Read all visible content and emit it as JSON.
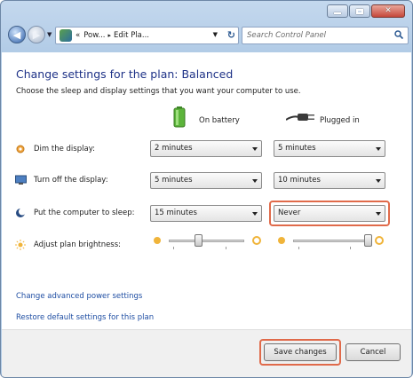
{
  "window": {
    "title_buttons": [
      "minimize",
      "maximize",
      "close"
    ]
  },
  "nav": {
    "back_icon": "back-arrow-icon",
    "forward_icon": "forward-arrow-icon",
    "breadcrumb_prefix": "«",
    "breadcrumb_1": "Pow...",
    "breadcrumb_2": "Edit Pla...",
    "breadcrumb_sep": "▸",
    "search_placeholder": "Search Control Panel"
  },
  "content": {
    "title": "Change settings for the plan: Balanced",
    "subtitle": "Choose the sleep and display settings that you want your computer to use.",
    "col_battery": "On battery",
    "col_plugged": "Plugged in",
    "rows": [
      {
        "label": "Dim the display:",
        "battery": "2 minutes",
        "plugged": "5 minutes"
      },
      {
        "label": "Turn off the display:",
        "battery": "5 minutes",
        "plugged": "10 minutes"
      },
      {
        "label": "Put the computer to sleep:",
        "battery": "15 minutes",
        "plugged": "Never"
      }
    ],
    "brightness": {
      "label": "Adjust plan brightness:",
      "battery_level": 0.4,
      "plugged_level": 1.0
    },
    "links": {
      "advanced": "Change advanced power settings",
      "restore": "Restore default settings for this plan"
    }
  },
  "footer": {
    "save_label": "Save changes",
    "cancel_label": "Cancel"
  },
  "colors": {
    "title_blue": "#1e3287",
    "link_blue": "#1f4ea3",
    "highlight": "#e06a4a"
  }
}
